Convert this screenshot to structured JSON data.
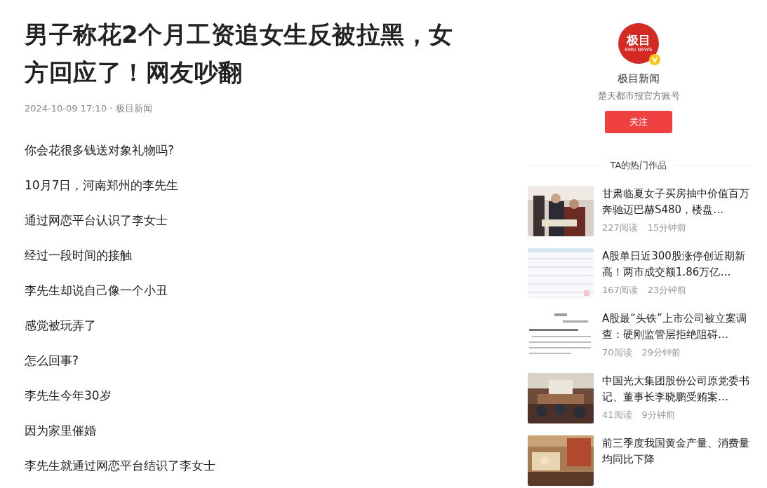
{
  "article": {
    "title": "男子称花2个月工资追女生反被拉黑，女方回应了！网友吵翻",
    "meta": "2024-10-09 17:10 · 极目新闻",
    "paragraphs": [
      "你会花很多钱送对象礼物吗?",
      "10月7日，河南郑州的李先生",
      "通过网恋平台认识了李女士",
      "经过一段时间的接触",
      "李先生却说自己像一个小丑",
      "感觉被玩弄了",
      "怎么回事?",
      "李先生今年30岁",
      "因为家里催婚",
      "李先生就通过网恋平台结识了李女士"
    ]
  },
  "author": {
    "logo_text": "极目",
    "logo_subtext": "EMU NEWS",
    "verified_mark": "V",
    "name": "极目新闻",
    "description": "楚天都市报官方账号",
    "follow_button": "关注"
  },
  "hot_works": {
    "heading": "TA的热门作品",
    "items": [
      {
        "title": "甘肃临夏女子买房抽中价值百万奔驰迈巴赫S480，楼盘…",
        "reads": "227阅读",
        "time": "15分钟前"
      },
      {
        "title": "A股单日近300股涨停创近期新高！两市成交额1.86万亿…",
        "reads": "167阅读",
        "time": "23分钟前"
      },
      {
        "title": "A股最“头铁”上市公司被立案调查：硬刚监管层拒绝阻碍…",
        "reads": "70阅读",
        "time": "29分钟前"
      },
      {
        "title": "中国光大集团股份公司原党委书记、董事长李晓鹏受贿案…",
        "reads": "41阅读",
        "time": "9分钟前"
      },
      {
        "title": "前三季度我国黄金产量、消费量均同比下降"
      }
    ]
  }
}
